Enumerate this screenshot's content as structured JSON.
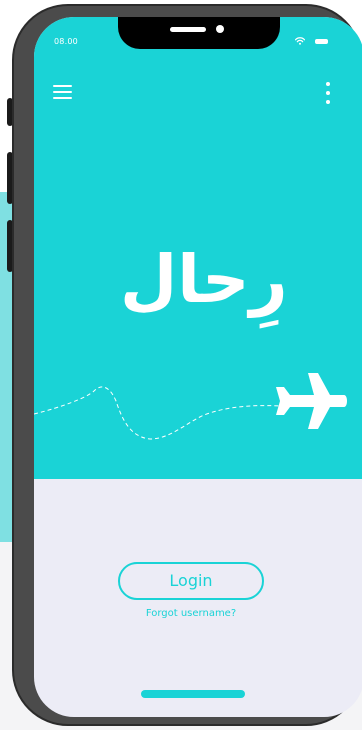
{
  "status_bar": {
    "time": "08.00",
    "icons": [
      "wifi-icon",
      "battery-icon"
    ]
  },
  "top_bar": {
    "menu_icon": "menu-icon",
    "more_icon": "more-vertical-icon"
  },
  "logo": {
    "text": "رِحال"
  },
  "decoration": {
    "icon": "airplane-icon"
  },
  "login": {
    "button_label": "Login",
    "forgot_label": "Forgot username?"
  },
  "colors": {
    "primary": "#1ad3d6",
    "surface": "#ececf6",
    "frame": "#4b4b4b",
    "accent_panel": "#7fe0e2"
  }
}
